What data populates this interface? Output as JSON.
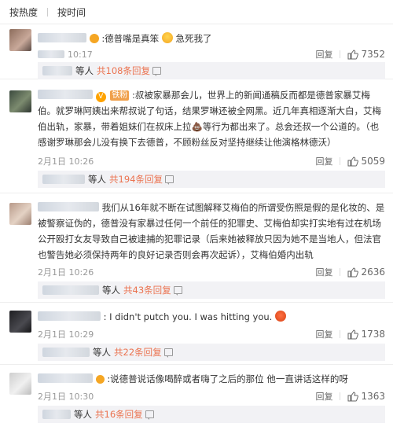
{
  "sort": {
    "hot": "按热度",
    "time": "按时间"
  },
  "labels": {
    "reply": "回复",
    "others": "等人",
    "total_prefix": "共"
  },
  "comments": [
    {
      "text": ":德普嘴是真笨",
      "text2": "急死我了",
      "time": "10:17",
      "likes": "7352",
      "reply_total": "共108条回复"
    },
    {
      "badge": "铁粉",
      "text": ":叔被家暴那会儿，世界上的新闻通稿反而都是德普家暴艾梅伯。就罗琳阿姨出来帮叔说了句话，结果罗琳还被全网黑。近几年真相逐渐大白，艾梅伯出轨，家暴，带着姐妹们在叔床上拉💩等行为都出来了。总会还叔一个公道的。（也感谢罗琳那会儿没有换下去德普，不顾粉丝反对坚持继续让他演格林德沃）",
      "time": "2月1日 10:26",
      "likes": "5059",
      "reply_total": "共194条回复"
    },
    {
      "text": "我们从16年就不断在试图解释艾梅伯的所谓受伤照是假的是化妆的、是被警察证伪的，德普没有家暴过任何一个前任的犯罪史、艾梅伯却实打实地有过在机场公开殴打女友导致自己被逮捕的犯罪记录（后来她被释放只因为她不是当地人，但法官也警告她必须保持两年的良好记录否则会再次起诉），艾梅伯婚内出轨",
      "time": "2月1日 10:26",
      "likes": "2636",
      "reply_total": "共43条回复"
    },
    {
      "text": ": I didn't putch you. I was hitting you.",
      "time": "2月1日 10:29",
      "likes": "1738",
      "reply_total": "共22条回复"
    },
    {
      "text": ":说德普说话像喝醉或者嗨了之后的那位 他一直讲话这样的呀",
      "time": "2月1日 10:30",
      "likes": "1363",
      "reply_total": "共16条回复"
    }
  ],
  "colors": {
    "accent": "#eb7350",
    "reply_bg": "#f2f2f5"
  }
}
